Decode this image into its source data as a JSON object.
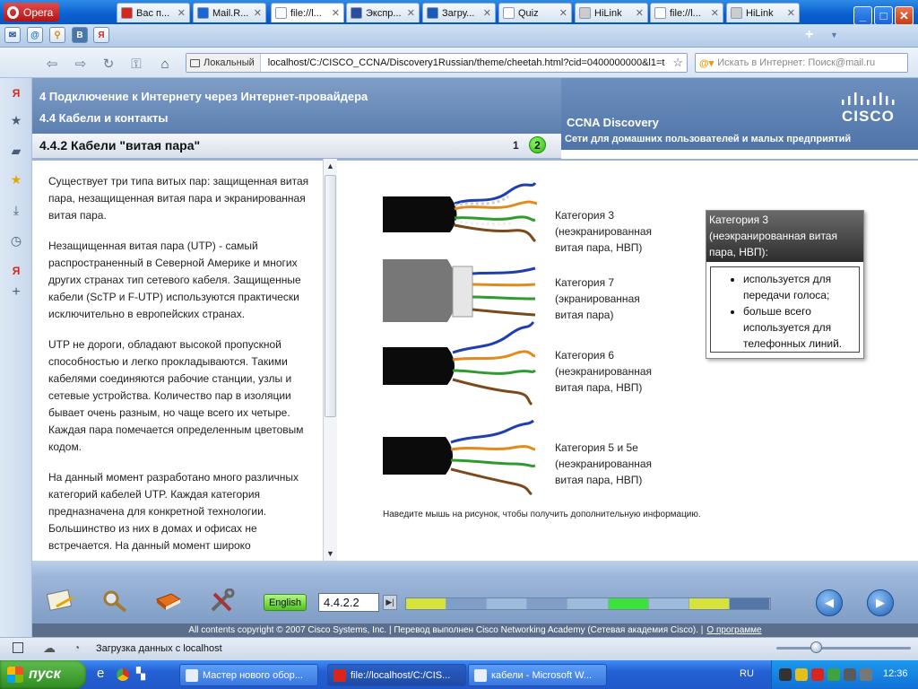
{
  "browser": {
    "menu_label": "Opera",
    "tabs": [
      {
        "label": "Вас п...",
        "color": "#d8251d"
      },
      {
        "label": "Mail.R...",
        "color": "#1b66d3"
      },
      {
        "label": "file://l...",
        "color": "#ffffff"
      },
      {
        "label": "Экспр...",
        "color": "#2a4f9c"
      },
      {
        "label": "Загру...",
        "color": "#1a5bb8"
      },
      {
        "label": "Quiz",
        "color": "#ffffff"
      },
      {
        "label": "HiLink",
        "color": "#cccccc"
      },
      {
        "label": "file://l...",
        "color": "#ffffff"
      },
      {
        "label": "HiLink",
        "color": "#cccccc"
      }
    ],
    "address": {
      "local_label": "Локальный",
      "url": "localhost/C:/CISCO_CCNA/Discovery1Russian/theme/cheetah.html?cid=0400000000&l1=t"
    },
    "search_placeholder": "Искать в Интернет: Поиск@mail.ru",
    "status_text": "Загрузка данных с localhost"
  },
  "course": {
    "chapter": "4 Подключение к Интернету через Интернет-провайдера",
    "section": "4.4 Кабели и контакты",
    "topic_title": "4.4.2 Кабели \"витая пара\"",
    "pages": [
      "1",
      "2"
    ],
    "course_name": "CCNA Discovery",
    "course_subtitle": "Сети для домашних пользователей и малых предприятий",
    "paragraphs": [
      "Существует три типа витых пар: защищенная витая пара, незащищенная витая пара и экранированная витая пара.",
      "Незащищенная витая пара (UTP) - самый распространенный в Северной Америке и многих других странах тип сетевого кабеля. Защищенные кабели (ScTP и F-UTP) используются практически исключительно в европейских странах.",
      "UTP не дороги, обладают высокой пропускной способностью и легко прокладываются. Такими кабелями соединяются рабочие станции, узлы и сетевые устройства. Количество пар в изоляции бывает очень разным, но чаще всего их четыре. Каждая пара помечается определенным цветовым кодом.",
      "На данный момент разработано много различных категорий кабелей UTP. Каждая категория предназначена для конкретной технологии. Большинство из них в домах и офисах не встречается. На данный момент широко"
    ],
    "cables": [
      {
        "name": "Категория 3",
        "type": "(неэкранированная",
        "abbr": "витая пара, НВП)"
      },
      {
        "name": "Категория 7",
        "type": "(экранированная",
        "abbr": "витая пара)"
      },
      {
        "name": "Категория 6",
        "type": "(неэкранированная",
        "abbr": "витая пара, НВП)"
      },
      {
        "name": "Категория 5 и 5e",
        "type": "(неэкранированная",
        "abbr": "витая пара, НВП)"
      }
    ],
    "hint": "Наведите мышь на рисунок, чтобы получить дополнительную информацию.",
    "tooltip": {
      "title": "Категория 3 (неэкранированная витая пара, НВП):",
      "items": [
        "используется для передачи голоса;",
        "больше всего используется для телефонных линий."
      ]
    },
    "toolbar": {
      "language": "English",
      "page_number": "4.4.2.2"
    },
    "progress_colors": [
      "#d7e23a",
      "#7f9fc8",
      "#9fbbdc",
      "#7f9fc8",
      "#9fbbdc",
      "#3ce23a",
      "#9fbbdc",
      "#d7e23a",
      "#5577a8"
    ],
    "footer": {
      "copyright": "All contents copyright © 2007 Cisco Systems, Inc. | Перевод выполнен Cisco Networking Academy (Сетевая академия Cisco). |",
      "about_link": "О программе"
    }
  },
  "taskbar": {
    "start_label": "пуск",
    "tasks": [
      {
        "label": "Мастер нового обор...",
        "active": false
      },
      {
        "label": "file://localhost/C:/CIS...",
        "active": true
      },
      {
        "label": "кабели - Microsoft W...",
        "active": false
      }
    ],
    "lang": "RU",
    "clock": "12:36"
  },
  "colors": {
    "cisco_blue": "#5d80b1",
    "accent_green": "#2fb619"
  }
}
